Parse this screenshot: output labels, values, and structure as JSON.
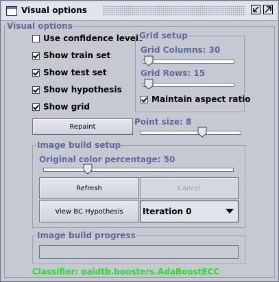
{
  "window": {
    "title": "Visual options"
  },
  "visual_options": {
    "legend": "Visual options",
    "checkboxes": [
      {
        "label": "Use confidence levels",
        "checked": false
      },
      {
        "label": "Show train set",
        "checked": true
      },
      {
        "label": "Show test set",
        "checked": true
      },
      {
        "label": "Show hypothesis",
        "checked": true
      },
      {
        "label": "Show grid",
        "checked": true
      }
    ],
    "repaint_label": "Repaint",
    "point_size_label": "Point size: 8",
    "point_size_fraction": 0.63
  },
  "grid_setup": {
    "legend": "Grid setup",
    "columns_label": "Grid Columns: 30",
    "columns_fraction": 0.02,
    "rows_label": "Grid Rows: 15",
    "rows_fraction": 0.02,
    "maintain_aspect_label": "Maintain aspect ratio",
    "maintain_aspect_checked": true
  },
  "image_build": {
    "legend": "Image build setup",
    "original_color_label": "Original color percentage: 50",
    "original_color_fraction": 0.22,
    "refresh_label": "Refresh",
    "cancel_label": "Cancel",
    "view_hypothesis_label": "View BC Hypothesis",
    "iteration_selected": "Iteration 0"
  },
  "progress": {
    "legend": "Image build progress",
    "fraction": 0
  },
  "status": {
    "classifier_text": "Classifier: oaidtb.boosters.AdaBoostECC"
  }
}
